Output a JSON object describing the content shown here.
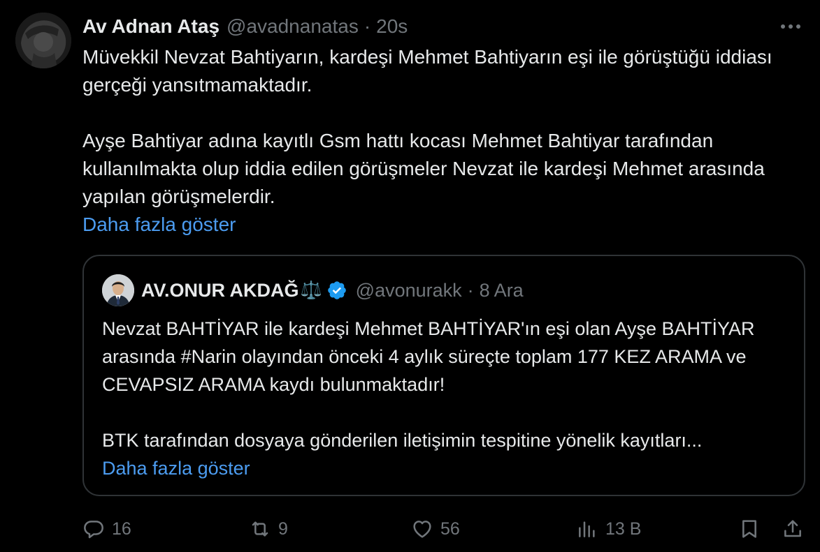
{
  "tweet": {
    "author_name": "Av Adnan Ataş",
    "author_handle": "@avadnanatas",
    "separator": "·",
    "time": "20s",
    "more_icon": "more-horizontal-icon",
    "paragraphs": [
      "Müvekkil Nevzat Bahtiyarın, kardeşi Mehmet Bahtiyarın eşi ile görüştüğü iddiası gerçeği yansıtmamaktadır.",
      "Ayşe Bahtiyar adına kayıtlı Gsm hattı kocası Mehmet Bahtiyar tarafından kullanılmakta olup iddia edilen görüşmeler Nevzat ile kardeşi Mehmet arasında yapılan görüşmelerdir."
    ],
    "show_more": "Daha fazla göster"
  },
  "quote": {
    "author_name": "AV.ONUR AKDAĞ",
    "author_emoji": "⚖️",
    "verified_icon": "verified-badge-icon",
    "author_handle": "@avonurakk",
    "separator": "·",
    "time": "8 Ara",
    "paragraphs": [
      "Nevzat BAHTİYAR ile kardeşi Mehmet BAHTİYAR'ın eşi olan Ayşe BAHTİYAR  arasında #Narin olayından önceki 4 aylık süreçte toplam 177 KEZ ARAMA ve CEVAPSIZ ARAMA kaydı bulunmaktadır!",
      "BTK tarafından dosyaya gönderilen iletişimin tespitine yönelik kayıtları..."
    ],
    "show_more": "Daha fazla göster"
  },
  "actions": {
    "reply": {
      "icon": "reply-icon",
      "count": "16"
    },
    "retweet": {
      "icon": "retweet-icon",
      "count": "9"
    },
    "like": {
      "icon": "heart-icon",
      "count": "56"
    },
    "views": {
      "icon": "views-icon",
      "count": "13 B"
    },
    "bookmark": {
      "icon": "bookmark-icon"
    },
    "share": {
      "icon": "share-icon"
    }
  },
  "colors": {
    "background": "#000000",
    "text": "#e7e9ea",
    "muted": "#71767b",
    "link": "#4c9cf0",
    "border": "#2f3336",
    "verified": "#1d9bf0"
  }
}
